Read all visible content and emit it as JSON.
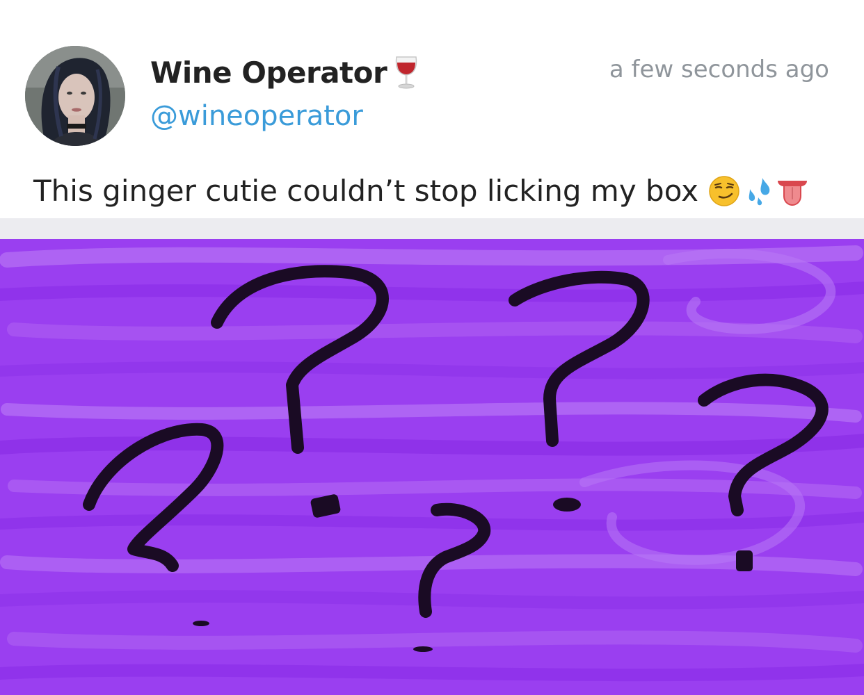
{
  "tweet": {
    "display_name": "Wine Operator",
    "handle": "@wineoperator",
    "timestamp": "a few seconds ago",
    "text": "This ginger cutie couldn’t stop licking my box",
    "name_icon": "wine-glass-icon",
    "text_emojis": [
      "smirking-face-emoji",
      "sweat-droplets-emoji",
      "tongue-emoji"
    ]
  },
  "colors": {
    "name": "#222222",
    "handle": "#3a9bd9",
    "timestamp": "#8f959b",
    "scribble": "#9a3ff0"
  }
}
